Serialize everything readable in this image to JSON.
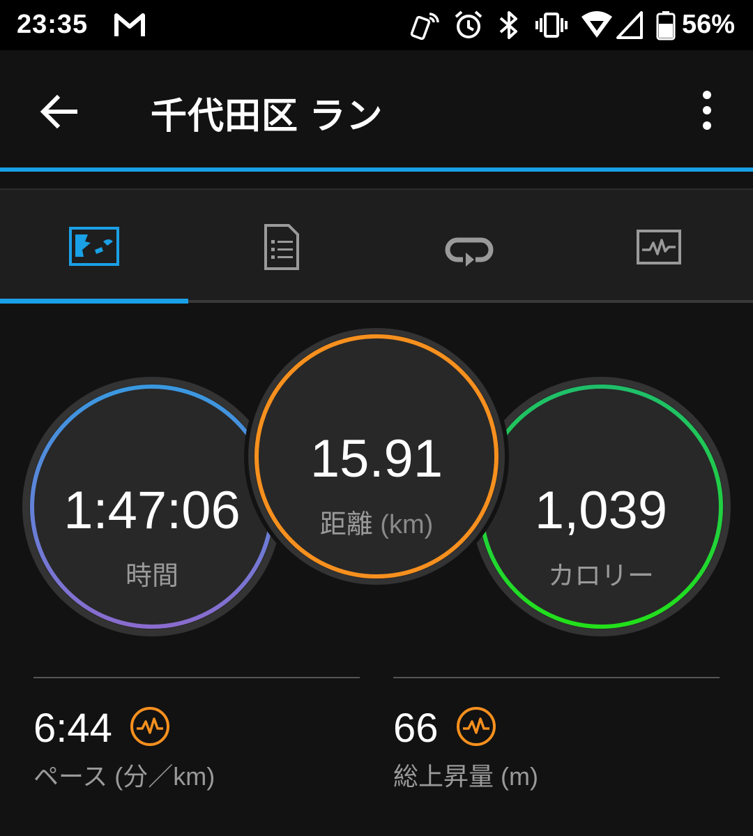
{
  "status_bar": {
    "time": "23:35",
    "battery": "56%",
    "icons": [
      "gmail-icon",
      "phone-sync-icon",
      "alarm-icon",
      "bluetooth-icon",
      "vibrate-icon",
      "wifi-icon",
      "signal-icon",
      "battery-icon"
    ]
  },
  "app_bar": {
    "title": "千代田区 ラン"
  },
  "tabs": [
    {
      "icon": "map-icon",
      "selected": true
    },
    {
      "icon": "details-icon",
      "selected": false
    },
    {
      "icon": "laps-icon",
      "selected": false
    },
    {
      "icon": "chart-icon",
      "selected": false
    }
  ],
  "rings": {
    "time": {
      "value": "1:47:06",
      "label": "時間"
    },
    "distance": {
      "value": "15.91",
      "label": "距離",
      "unit": "(km)"
    },
    "calories": {
      "value": "1,039",
      "label": "カロリー"
    }
  },
  "stats": {
    "pace": {
      "value": "6:44",
      "label": "ペース",
      "unit": "(分／km)"
    },
    "ascent": {
      "value": "66",
      "label": "総上昇量",
      "unit": "(m)"
    }
  },
  "colors": {
    "accent": "#1aa0e6",
    "time_ring_top": "#3a98e0",
    "time_ring_bottom": "#8a6ccf",
    "distance_ring": "#f7901e",
    "calories_ring_top": "#1fbf6a",
    "calories_ring_bottom": "#22e01a",
    "stat_icon": "#f7901e"
  }
}
